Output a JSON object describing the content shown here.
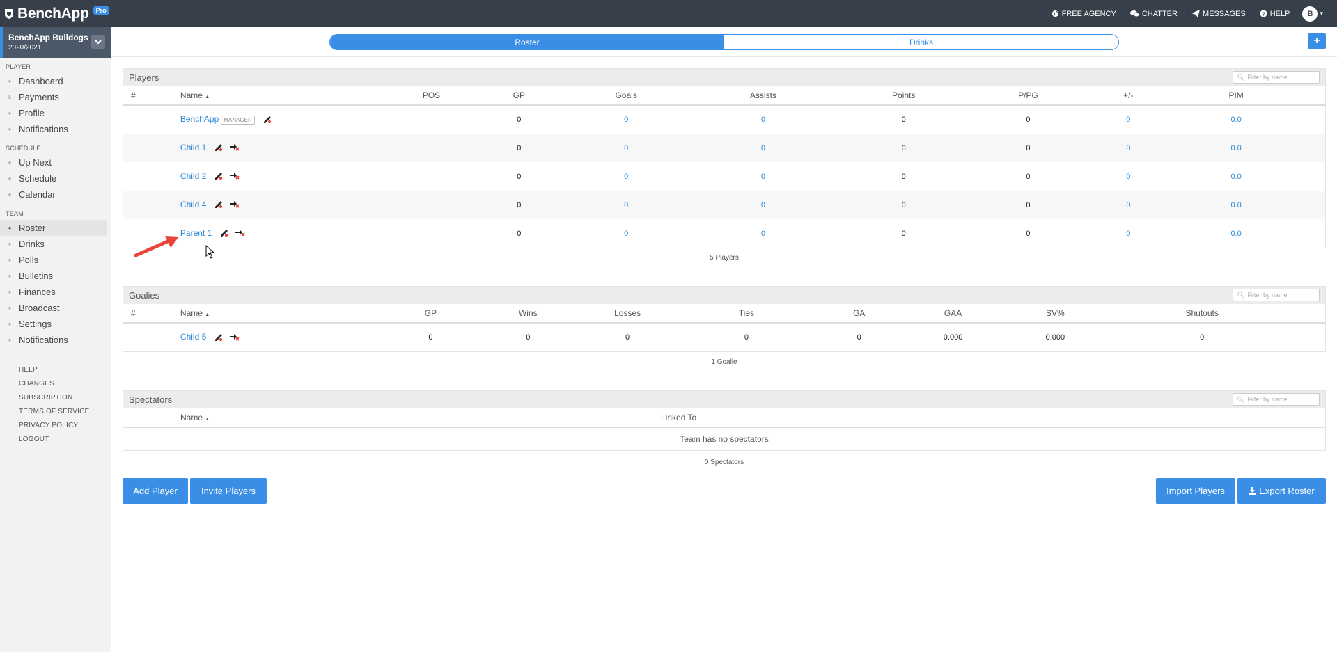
{
  "topbar": {
    "brand": "BenchApp",
    "badge": "Pro",
    "nav": [
      {
        "label": "Free Agency",
        "icon": "globe-icon"
      },
      {
        "label": "Chatter",
        "icon": "chat-icon"
      },
      {
        "label": "Messages",
        "icon": "paper-plane-icon"
      },
      {
        "label": "Help",
        "icon": "question-icon"
      }
    ],
    "avatar_initial": "B"
  },
  "sidebar": {
    "team_name": "BenchApp Bulldogs",
    "season": "2020/2021",
    "sections": [
      {
        "title": "Player",
        "items": [
          "Dashboard",
          "Payments",
          "Profile",
          "Notifications"
        ]
      },
      {
        "title": "Schedule",
        "items": [
          "Up Next",
          "Schedule",
          "Calendar"
        ]
      },
      {
        "title": "Team",
        "items": [
          "Roster",
          "Drinks",
          "Polls",
          "Bulletins",
          "Finances",
          "Broadcast",
          "Settings",
          "Notifications"
        ]
      }
    ],
    "active_item": "Roster",
    "footer_links": [
      "Help",
      "Changes",
      "Subscription",
      "Terms of Service",
      "Privacy Policy",
      "Logout"
    ]
  },
  "tabs": {
    "roster": "Roster",
    "drinks": "Drinks"
  },
  "filter_placeholder": "Filter by name",
  "players": {
    "title": "Players",
    "columns": [
      "#",
      "Name",
      "POS",
      "GP",
      "Goals",
      "Assists",
      "Points",
      "P/PG",
      "+/-",
      "PIM"
    ],
    "rows": [
      {
        "name": "BenchApp",
        "badge": "MANAGER",
        "gp": "0",
        "goals": "0",
        "assists": "0",
        "points": "0",
        "ppg": "0",
        "pm": "0",
        "pim": "0.0"
      },
      {
        "name": "Child 1",
        "gp": "0",
        "goals": "0",
        "assists": "0",
        "points": "0",
        "ppg": "0",
        "pm": "0",
        "pim": "0.0"
      },
      {
        "name": "Child 2",
        "gp": "0",
        "goals": "0",
        "assists": "0",
        "points": "0",
        "ppg": "0",
        "pm": "0",
        "pim": "0.0"
      },
      {
        "name": "Child 4",
        "gp": "0",
        "goals": "0",
        "assists": "0",
        "points": "0",
        "ppg": "0",
        "pm": "0",
        "pim": "0.0"
      },
      {
        "name": "Parent 1",
        "gp": "0",
        "goals": "0",
        "assists": "0",
        "points": "0",
        "ppg": "0",
        "pm": "0",
        "pim": "0.0"
      }
    ],
    "count": "5 Players"
  },
  "goalies": {
    "title": "Goalies",
    "columns": [
      "#",
      "Name",
      "GP",
      "Wins",
      "Losses",
      "Ties",
      "GA",
      "GAA",
      "SV%",
      "Shutouts"
    ],
    "rows": [
      {
        "name": "Child 5",
        "gp": "0",
        "wins": "0",
        "losses": "0",
        "ties": "0",
        "ga": "0",
        "gaa": "0.000",
        "sv": "0.000",
        "shutouts": "0"
      }
    ],
    "count": "1 Goalie"
  },
  "spectators": {
    "title": "Spectators",
    "columns": [
      "Name",
      "Linked To"
    ],
    "empty": "Team has no spectators",
    "count": "0 Spectators"
  },
  "buttons": {
    "add_player": "Add Player",
    "invite_players": "Invite Players",
    "import_players": "Import Players",
    "export_roster": "Export Roster"
  },
  "colors": {
    "accent": "#3a8ee6",
    "topbar": "#363f4a",
    "annotation_arrow": "#e8443a"
  }
}
